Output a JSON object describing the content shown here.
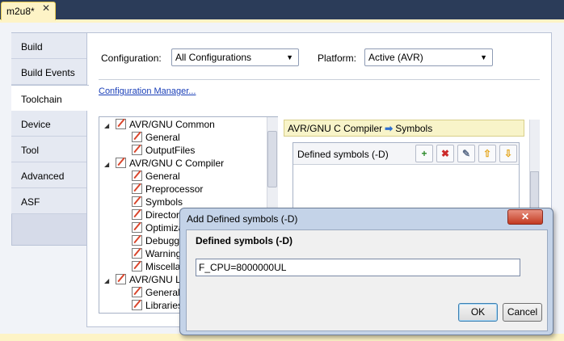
{
  "document_tab": {
    "title": "m2u8*",
    "close": "✕"
  },
  "nav": {
    "items": [
      {
        "label": "Build"
      },
      {
        "label": "Build Events"
      },
      {
        "label": "Toolchain",
        "active": true
      },
      {
        "label": "Device"
      },
      {
        "label": "Tool"
      },
      {
        "label": "Advanced"
      },
      {
        "label": "ASF"
      }
    ]
  },
  "config": {
    "configuration_label": "Configuration:",
    "configuration_value": "All Configurations",
    "platform_label": "Platform:",
    "platform_value": "Active (AVR)",
    "manager_link": "Configuration Manager..."
  },
  "tree": {
    "nodes": [
      {
        "label": "AVR/GNU Common",
        "expander": "◢"
      },
      {
        "label": "General"
      },
      {
        "label": "OutputFiles"
      },
      {
        "label": "AVR/GNU C Compiler",
        "expander": "◢"
      },
      {
        "label": "General"
      },
      {
        "label": "Preprocessor"
      },
      {
        "label": "Symbols"
      },
      {
        "label": "Directories"
      },
      {
        "label": "Optimization"
      },
      {
        "label": "Debugging"
      },
      {
        "label": "Warnings"
      },
      {
        "label": "Miscellaneous"
      },
      {
        "label": "AVR/GNU Linker",
        "expander": "◢"
      },
      {
        "label": "General"
      },
      {
        "label": "Libraries"
      }
    ]
  },
  "panel": {
    "breadcrumb_left": "AVR/GNU C Compiler",
    "breadcrumb_arrow": "➡",
    "breadcrumb_right": "Symbols",
    "symbols_header": "Defined symbols (-D)",
    "toolbar": {
      "add": "+",
      "delete": "✖",
      "edit": "✎",
      "move_up": "⇧",
      "move_down": "⇩"
    }
  },
  "dialog": {
    "title": "Add Defined symbols (-D)",
    "close": "✕",
    "field_label": "Defined symbols (-D)",
    "field_value": "F_CPU=8000000UL",
    "ok": "OK",
    "cancel": "Cancel"
  }
}
